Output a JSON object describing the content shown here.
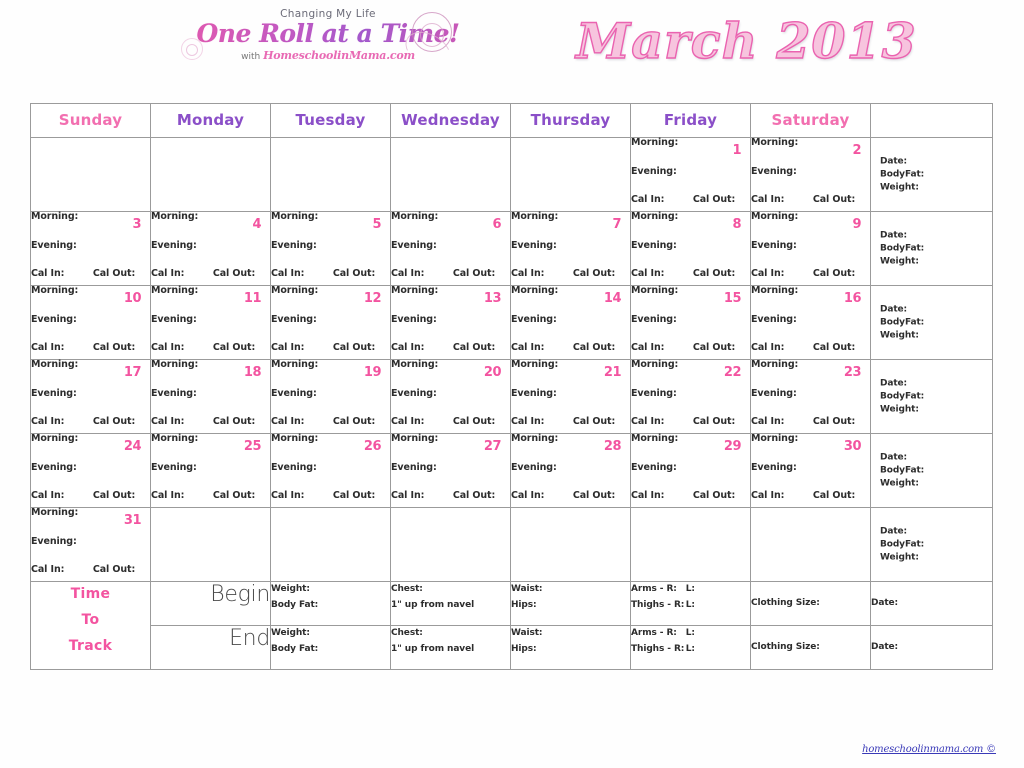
{
  "header": {
    "logo": {
      "tagline": "Changing My Life",
      "main": "One Roll at a Time!",
      "with": "with",
      "site": "HomeschoolinMama.com"
    },
    "month_title": "March 2013"
  },
  "colors": {
    "pink": "#f354a0",
    "purple": "#8b4fc8",
    "header_pink": "#f26fb0",
    "grid": "#9b9b9b",
    "text": "#2d2d2d",
    "link": "#3a3ab8"
  },
  "calendar": {
    "day_headers": [
      {
        "label": "Sunday",
        "color": "pink"
      },
      {
        "label": "Monday",
        "color": "purple"
      },
      {
        "label": "Tuesday",
        "color": "purple"
      },
      {
        "label": "Wednesday",
        "color": "purple"
      },
      {
        "label": "Thursday",
        "color": "purple"
      },
      {
        "label": "Friday",
        "color": "purple"
      },
      {
        "label": "Saturday",
        "color": "pink"
      },
      {
        "label": "",
        "color": "pink"
      }
    ],
    "cell_fields": {
      "morning": "Morning:",
      "evening": "Evening:",
      "cal_in": "Cal In:",
      "cal_out": "Cal Out:"
    },
    "side_fields": {
      "date": "Date:",
      "bodyfat": "BodyFat:",
      "weight": "Weight:"
    },
    "weeks": [
      {
        "days": [
          null,
          null,
          null,
          null,
          null,
          1,
          2
        ],
        "side": true
      },
      {
        "days": [
          3,
          4,
          5,
          6,
          7,
          8,
          9
        ],
        "side": true
      },
      {
        "days": [
          10,
          11,
          12,
          13,
          14,
          15,
          16
        ],
        "side": true
      },
      {
        "days": [
          17,
          18,
          19,
          20,
          21,
          22,
          23
        ],
        "side": true
      },
      {
        "days": [
          24,
          25,
          26,
          27,
          28,
          29,
          30
        ],
        "side": true
      },
      {
        "days": [
          31,
          null,
          null,
          null,
          null,
          null,
          null
        ],
        "side": true
      }
    ]
  },
  "tracker": {
    "title_line1": "Time",
    "title_line2": "To",
    "title_line3": "Track",
    "rows": [
      {
        "stage": "Begin",
        "weight": "Weight:",
        "body_fat": "Body Fat:",
        "chest": "Chest:",
        "chest_note": "1\" up from navel",
        "waist": "Waist:",
        "hips": "Hips:",
        "arms": "Arms  -  R:",
        "arms_l": "L:",
        "thighs": "Thighs  - R:",
        "thighs_l": "L:",
        "clothing_size": "Clothing Size:",
        "date": "Date:"
      },
      {
        "stage": "End",
        "weight": "Weight:",
        "body_fat": "Body Fat:",
        "chest": "Chest:",
        "chest_note": "1\" up from navel",
        "waist": "Waist:",
        "hips": "Hips:",
        "arms": "Arms  -  R:",
        "arms_l": "L:",
        "thighs": "Thighs  - R:",
        "thighs_l": "L:",
        "clothing_size": "Clothing Size:",
        "date": "Date:"
      }
    ]
  },
  "footer": {
    "link": "homeschoolinmama.com  ©"
  }
}
